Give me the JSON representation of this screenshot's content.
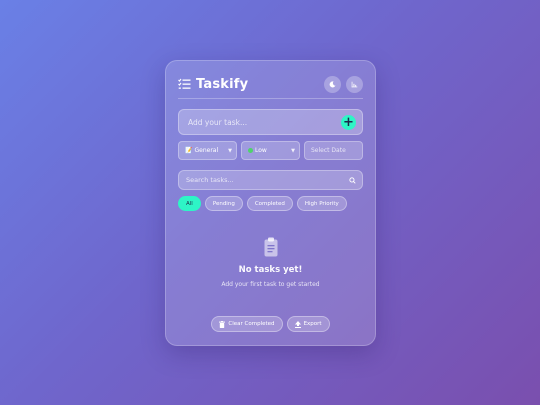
{
  "app": {
    "title": "Taskify"
  },
  "header": {
    "theme_icon": "moon-icon",
    "stats_icon": "bar-chart-icon"
  },
  "task_input": {
    "placeholder": "Add your task...",
    "add_label": "+"
  },
  "category": {
    "icon": "📝",
    "selected": "General"
  },
  "priority": {
    "selected": "Low",
    "dot_color": "#4fd36b"
  },
  "date": {
    "placeholder": "Select Date"
  },
  "search": {
    "placeholder": "Search tasks..."
  },
  "filters": [
    "All",
    "Pending",
    "Completed",
    "High Priority"
  ],
  "empty_state": {
    "title": "No tasks yet!",
    "subtitle": "Add your first task to get started"
  },
  "footer": {
    "clear_label": "Clear Completed",
    "export_label": "Export"
  },
  "colors": {
    "accent": "#2ef5c6"
  }
}
